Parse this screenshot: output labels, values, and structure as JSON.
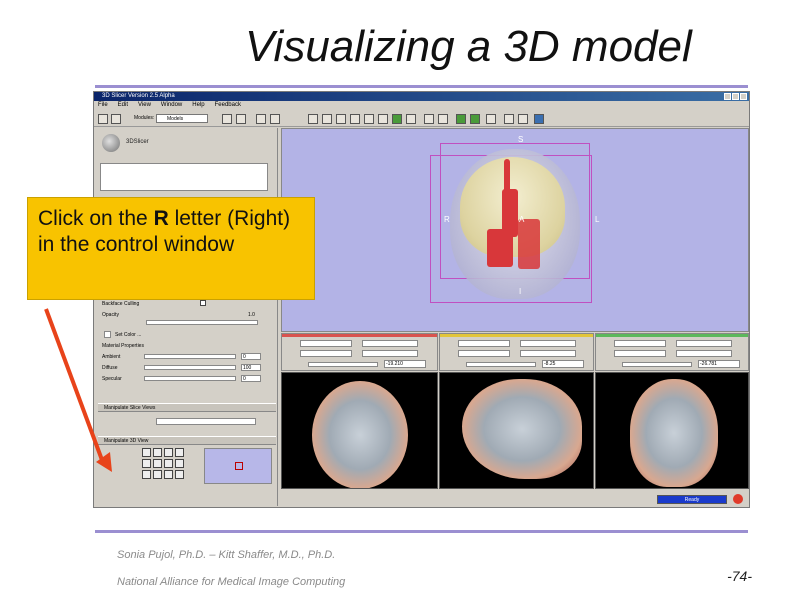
{
  "slide": {
    "title": "Visualizing a 3D model",
    "footer_authors": "Sonia Pujol, Ph.D. – Kitt Shaffer, M.D., Ph.D.",
    "footer_org": "National Alliance for Medical Image Computing",
    "page_number": "-74-"
  },
  "callout": {
    "part1": "Click on the ",
    "bold": "R",
    "part2": " letter (Right) in the control window"
  },
  "app": {
    "window_title": "3D Slicer Version 2.5 Alpha",
    "menu": [
      "File",
      "Edit",
      "View",
      "Window",
      "Help",
      "Feedback"
    ],
    "modules_label": "Modules:",
    "modules_value": "Models",
    "logo_text": "3DSlicer",
    "props": {
      "backface_culling": "Backface Culling",
      "opacity": "Opacity",
      "opacity_value": "1.0",
      "set_color": "Set Color ...",
      "material_properties": "Material Properties",
      "ambient": "Ambient",
      "ambient_value": "0",
      "diffuse": "Diffuse",
      "diffuse_value": "100",
      "specular": "Specular",
      "specular_value": "0"
    },
    "section_slice_views": "Manipulate Slice Views",
    "section_3d_view": "Manipulate 3D View",
    "orient": {
      "s": "S",
      "r": "R",
      "l": "L",
      "a": "A",
      "i": "I"
    },
    "slices": [
      {
        "value": "-19.210"
      },
      {
        "value": "-8.25"
      },
      {
        "value": "-26.781"
      }
    ],
    "status_progress": "Ready"
  },
  "colors": {
    "callout_bg": "#f8c300",
    "rule": "#9b8fd1",
    "view_bg": "#b3b3e6",
    "arrow": "#e8431a"
  }
}
